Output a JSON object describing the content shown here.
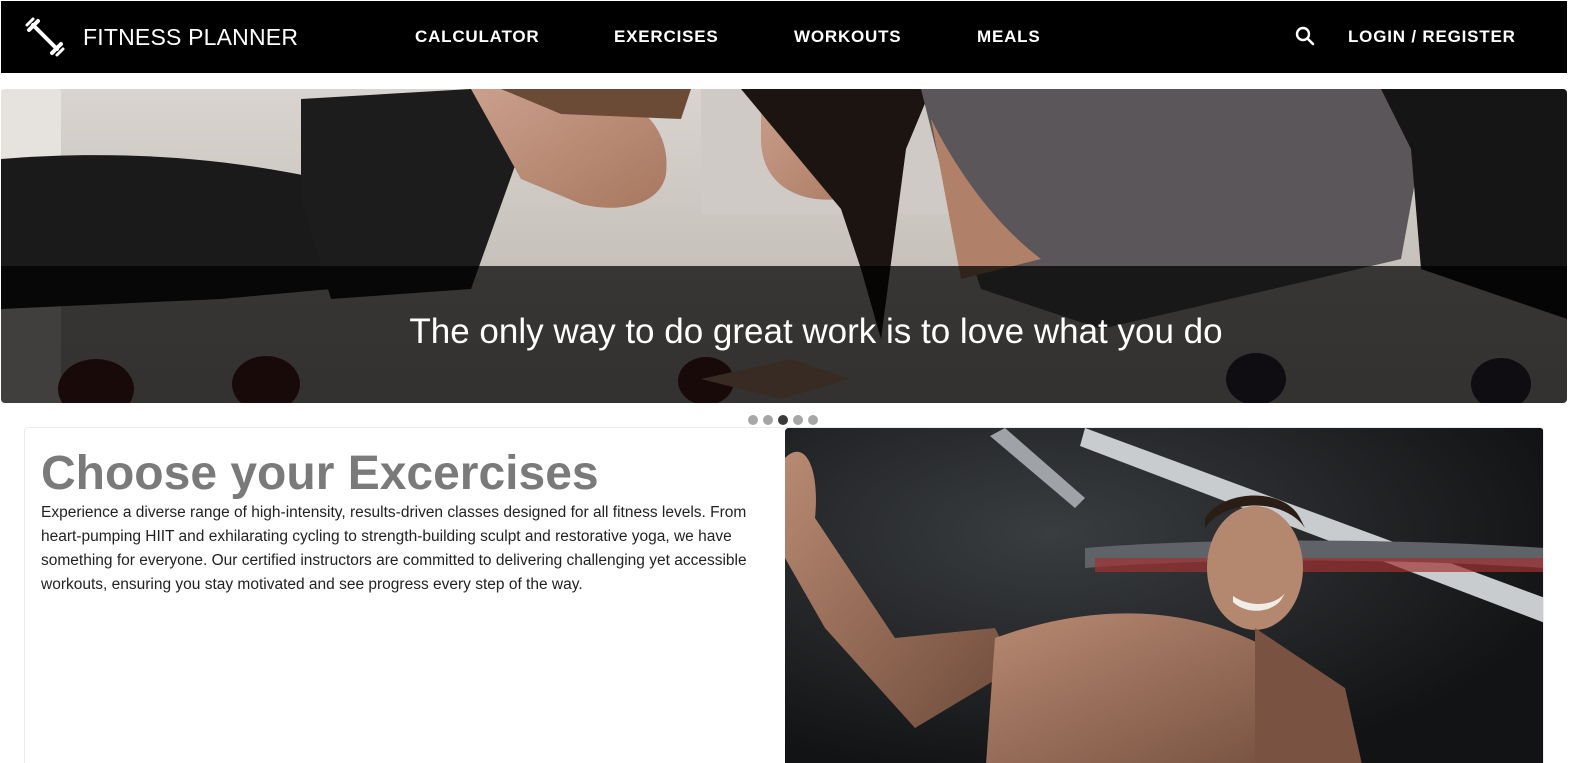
{
  "brand": {
    "name": "FITNESS PLANNER",
    "icon": "dumbbell-icon"
  },
  "nav": {
    "links": [
      "CALCULATOR",
      "EXERCISES",
      "WORKOUTS",
      "MEALS"
    ],
    "search_icon": "search-icon",
    "login_label": "LOGIN / REGISTER"
  },
  "hero": {
    "caption": "The only way to do great work is to love what you do",
    "slide_count": 5,
    "active_slide": 3
  },
  "section": {
    "title": "Choose your Excercises",
    "body": "Experience a diverse range of high-intensity, results-driven classes designed for all fitness levels. From heart-pumping HIIT and exhilarating cycling to strength-building sculpt and restorative yoga, we have something for everyone. Our certified instructors are committed to delivering challenging yet accessible workouts, ensuring you stay motivated and see progress every step of the way."
  },
  "colors": {
    "nav_bg": "#000000",
    "title_gray": "#7a7a7a",
    "dot_active": "#3a3a3a",
    "dot_inactive": "#a6a6a6"
  }
}
